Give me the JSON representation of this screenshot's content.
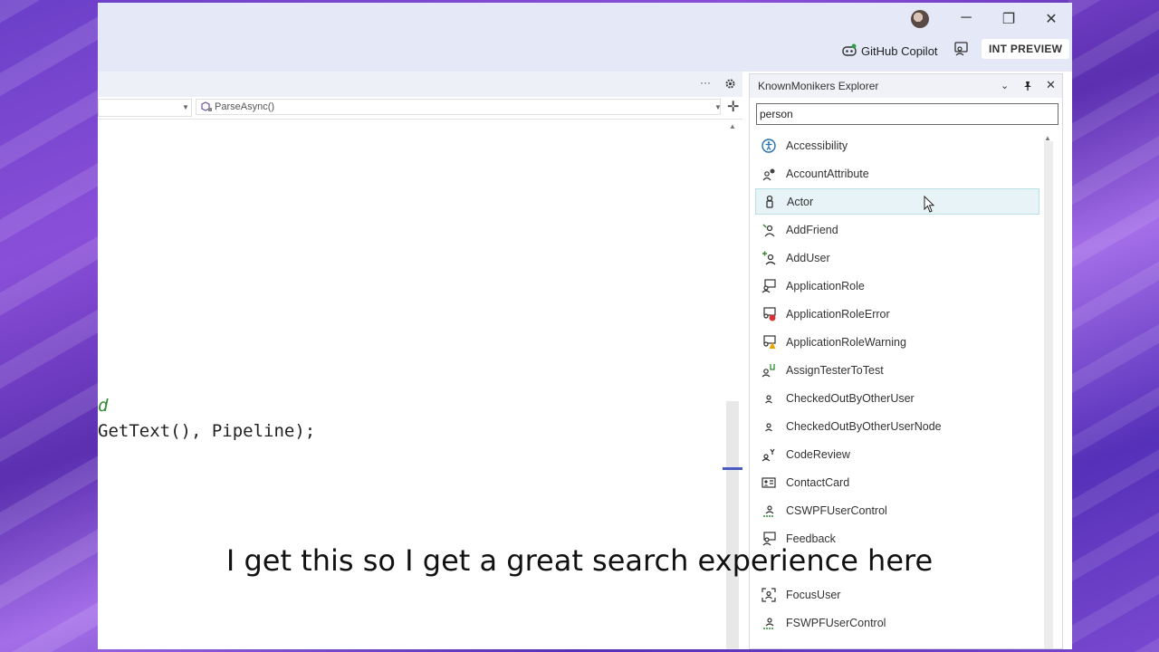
{
  "window": {
    "title_controls": {
      "minimize": "─",
      "restore": "❐",
      "close": "✕"
    },
    "copilot_label": "GitHub Copilot",
    "badge": "INT PREVIEW"
  },
  "editor": {
    "tab_overflow": "···",
    "member_dropdown": "ParseAsync()",
    "code_lines": [
      {
        "text": "d",
        "color": "#2e8b2e"
      },
      {
        "text": "GetText(), Pipeline);",
        "color": "#222222"
      }
    ]
  },
  "panel": {
    "title": "KnownMonikers Explorer",
    "search_value": "person",
    "items": [
      {
        "label": "Accessibility",
        "icon": "accessibility-icon",
        "selected": false
      },
      {
        "label": "AccountAttribute",
        "icon": "account-attribute-icon",
        "selected": false
      },
      {
        "label": "Actor",
        "icon": "actor-icon",
        "selected": true
      },
      {
        "label": "AddFriend",
        "icon": "add-friend-icon",
        "selected": false
      },
      {
        "label": "AddUser",
        "icon": "add-user-icon",
        "selected": false
      },
      {
        "label": "ApplicationRole",
        "icon": "application-role-icon",
        "selected": false
      },
      {
        "label": "ApplicationRoleError",
        "icon": "application-role-error-icon",
        "selected": false
      },
      {
        "label": "ApplicationRoleWarning",
        "icon": "application-role-warning-icon",
        "selected": false
      },
      {
        "label": "AssignTesterToTest",
        "icon": "assign-tester-icon",
        "selected": false
      },
      {
        "label": "CheckedOutByOtherUser",
        "icon": "user-small-icon",
        "selected": false
      },
      {
        "label": "CheckedOutByOtherUserNode",
        "icon": "user-small-icon",
        "selected": false
      },
      {
        "label": "CodeReview",
        "icon": "code-review-icon",
        "selected": false
      },
      {
        "label": "ContactCard",
        "icon": "contact-card-icon",
        "selected": false
      },
      {
        "label": "CSWPFUserControl",
        "icon": "user-control-icon",
        "selected": false
      },
      {
        "label": "Feedback",
        "icon": "feedback-icon",
        "selected": false
      },
      {
        "label": "",
        "icon": "",
        "selected": false
      },
      {
        "label": "FocusUser",
        "icon": "focus-user-icon",
        "selected": false
      },
      {
        "label": "FSWPFUserControl",
        "icon": "user-control-icon",
        "selected": false
      }
    ]
  },
  "caption": "I get this so I get a great search experience here"
}
